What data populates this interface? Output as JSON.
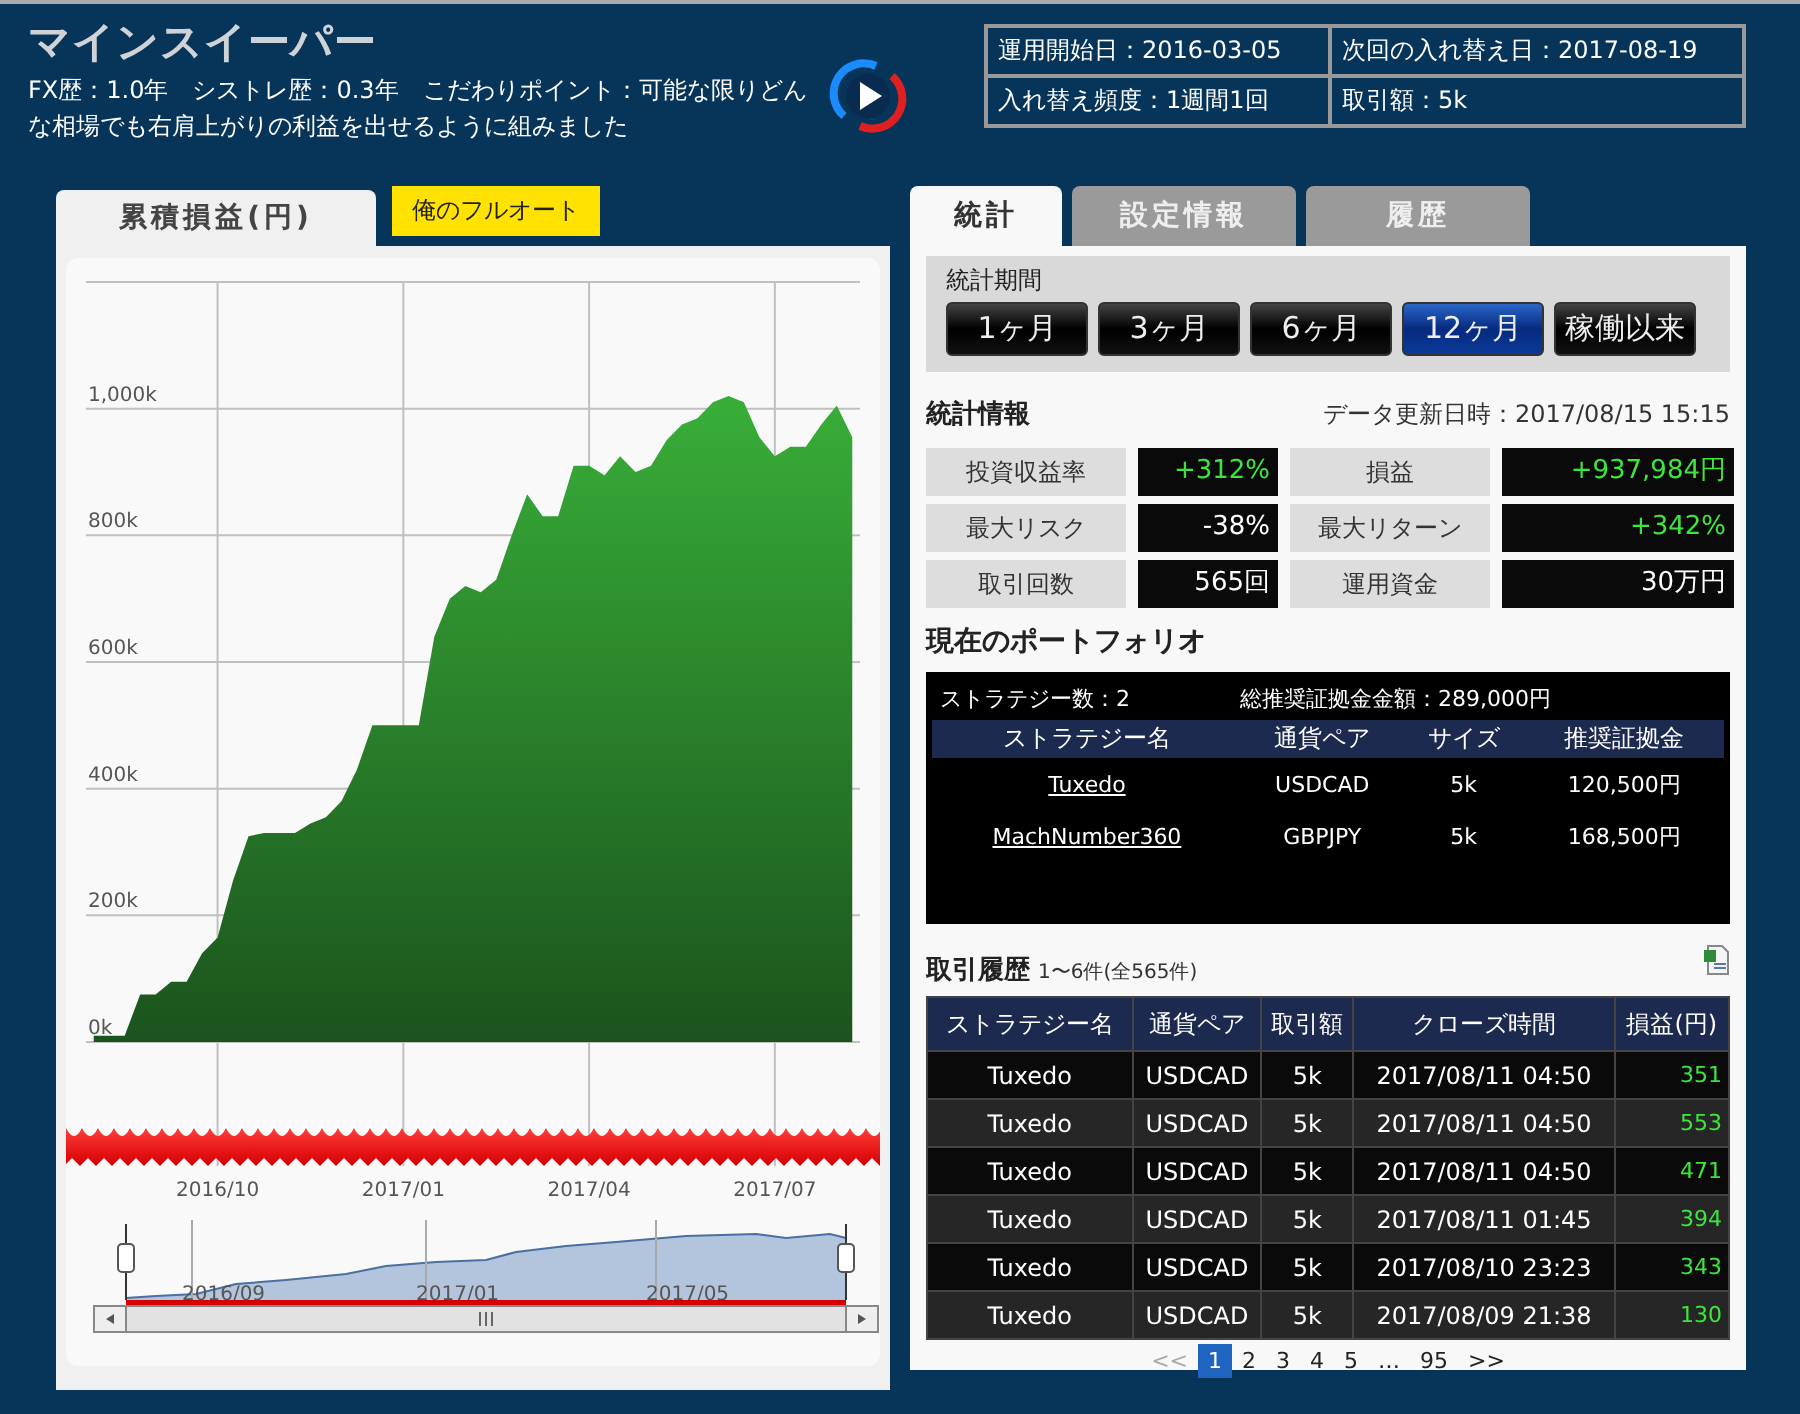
{
  "header": {
    "title": "マインスイーパー",
    "description": "FX歴：1.0年　シストレ歴：0.3年　こだわりポイント：可能な限りどんな相場でも右肩上がりの利益を出せるように組みました",
    "info": [
      "運用開始日：2016-03-05",
      "次回の入れ替え日：2017-08-19",
      "入れ替え頻度：1週間1回",
      "取引額：5k"
    ]
  },
  "left_tabs": [
    {
      "label": "累積損益(円)",
      "selected": true
    }
  ],
  "badge": "俺のフルオート",
  "chart_data": {
    "type": "area",
    "categories": [
      null,
      null,
      null,
      null,
      null,
      null,
      null,
      null,
      "2016/10",
      null,
      null,
      null,
      null,
      null,
      null,
      null,
      null,
      null,
      null,
      null,
      "2017/01",
      null,
      null,
      null,
      null,
      null,
      null,
      null,
      null,
      null,
      null,
      null,
      "2017/04",
      null,
      null,
      null,
      null,
      null,
      null,
      null,
      null,
      null,
      null,
      null,
      "2017/07",
      null,
      null,
      null,
      null,
      null
    ],
    "values": [
      10,
      10,
      10,
      75,
      75,
      95,
      95,
      140,
      165,
      255,
      325,
      330,
      330,
      330,
      345,
      355,
      380,
      430,
      500,
      500,
      500,
      500,
      640,
      700,
      720,
      710,
      730,
      800,
      865,
      830,
      830,
      910,
      910,
      895,
      925,
      900,
      910,
      950,
      975,
      985,
      1010,
      1020,
      1010,
      955,
      925,
      940,
      940,
      975,
      1005,
      955
    ],
    "ylim": [
      0,
      1200
    ],
    "grid": true,
    "yticks": [
      {
        "value": 0,
        "label": "0k"
      },
      {
        "value": 200,
        "label": "200k"
      },
      {
        "value": 400,
        "label": "400k"
      },
      {
        "value": 600,
        "label": "600k"
      },
      {
        "value": 800,
        "label": "800k"
      },
      {
        "value": 1000,
        "label": "1,000k"
      }
    ]
  },
  "navigator": {
    "labels": [
      "2016/09",
      "2017/01",
      "2017/05"
    ]
  },
  "right_tabs": [
    {
      "label": "統計",
      "selected": true
    },
    {
      "label": "設定情報",
      "selected": false
    },
    {
      "label": "履歴",
      "selected": false
    }
  ],
  "period": {
    "title": "統計期間",
    "options": [
      {
        "label": "1ヶ月",
        "selected": false
      },
      {
        "label": "3ヶ月",
        "selected": false
      },
      {
        "label": "6ヶ月",
        "selected": false
      },
      {
        "label": "12ヶ月",
        "selected": true
      },
      {
        "label": "稼働以来",
        "selected": false
      }
    ]
  },
  "stats": {
    "title": "統計情報",
    "updated": "データ更新日時：2017/08/15 15:15",
    "items": [
      {
        "label": "投資収益率",
        "value": "+312%",
        "highlight": true
      },
      {
        "label": "損益",
        "value": "+937,984円",
        "highlight": true
      },
      {
        "label": "最大リスク",
        "value": "-38%",
        "highlight": false
      },
      {
        "label": "最大リターン",
        "value": "+342%",
        "highlight": true
      },
      {
        "label": "取引回数",
        "value": "565回",
        "highlight": false
      },
      {
        "label": "運用資金",
        "value": "30万円",
        "highlight": false
      }
    ]
  },
  "portfolio": {
    "title": "現在のポートフォリオ",
    "count": "ストラテジー数：2",
    "total": "総推奨証拠金金額：289,000円",
    "columns": [
      "ストラテジー名",
      "通貨ペア",
      "サイズ",
      "推奨証拠金"
    ],
    "rows": [
      [
        "Tuxedo",
        "USDCAD",
        "5k",
        "120,500円"
      ],
      [
        "MachNumber360",
        "GBPJPY",
        "5k",
        "168,500円"
      ]
    ]
  },
  "history": {
    "title": "取引履歴",
    "range": "1〜6件(全565件)",
    "columns": [
      "ストラテジー名",
      "通貨ペア",
      "取引額",
      "クローズ時間",
      "損益(円)"
    ],
    "rows": [
      [
        "Tuxedo",
        "USDCAD",
        "5k",
        "2017/08/11 04:50",
        "351"
      ],
      [
        "Tuxedo",
        "USDCAD",
        "5k",
        "2017/08/11 04:50",
        "553"
      ],
      [
        "Tuxedo",
        "USDCAD",
        "5k",
        "2017/08/11 04:50",
        "471"
      ],
      [
        "Tuxedo",
        "USDCAD",
        "5k",
        "2017/08/11 01:45",
        "394"
      ],
      [
        "Tuxedo",
        "USDCAD",
        "5k",
        "2017/08/10 23:23",
        "343"
      ],
      [
        "Tuxedo",
        "USDCAD",
        "5k",
        "2017/08/09 21:38",
        "130"
      ]
    ]
  },
  "pagination": {
    "prev": "<<",
    "pages": [
      {
        "label": "1",
        "selected": true
      },
      {
        "label": "2",
        "selected": false
      },
      {
        "label": "3",
        "selected": false
      },
      {
        "label": "4",
        "selected": false
      },
      {
        "label": "5",
        "selected": false
      },
      {
        "label": "…",
        "selected": false
      },
      {
        "label": "95",
        "selected": false
      }
    ],
    "next": ">>"
  }
}
